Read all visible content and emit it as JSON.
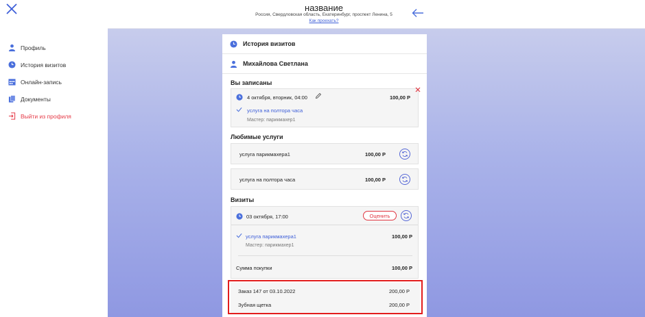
{
  "sidebar": {
    "items": [
      {
        "label": "Профиль",
        "icon": "user-icon"
      },
      {
        "label": "История визитов",
        "icon": "clock-icon"
      },
      {
        "label": "Онлайн-запись",
        "icon": "calendar-icon"
      },
      {
        "label": "Документы",
        "icon": "documents-icon"
      },
      {
        "label": "Выйти из профиля",
        "icon": "logout-icon"
      }
    ]
  },
  "header": {
    "title": "название",
    "address": "Россия, Свердловская область, Екатеринбург, проспект Ленина, 5",
    "directions_link": "Как проехать?"
  },
  "panel": {
    "history_title": "История визитов",
    "client_name": "Михайлова Светлана",
    "booked": {
      "title": "Вы записаны",
      "date": "4 октября, вторник, 04:00",
      "price": "100,00 Р",
      "service": "услуга на полтора часа",
      "master": "Мастер: парикмахер1"
    },
    "favorites": {
      "title": "Любимые услуги",
      "items": [
        {
          "name": "услуга парикмахера1",
          "price": "100,00 Р"
        },
        {
          "name": "услуга на полтора часа",
          "price": "100,00 Р"
        }
      ]
    },
    "visits": {
      "title": "Визиты",
      "date": "03 октября, 17:00",
      "rate_button": "Оценить",
      "service": "услуга парикмахера1",
      "service_price": "100,00 Р",
      "master": "Мастер: парикмахер1",
      "total_label": "Сумма покупки",
      "total_value": "100,00 Р"
    },
    "order": {
      "label": "Заказ 147 от 03.10.2022",
      "price": "200,00 Р",
      "item": "Зубная щетка",
      "item_price": "200,00 Р"
    }
  },
  "colors": {
    "accent": "#3d5ed8",
    "danger": "#e53946",
    "highlight_border": "#e21c1c"
  }
}
